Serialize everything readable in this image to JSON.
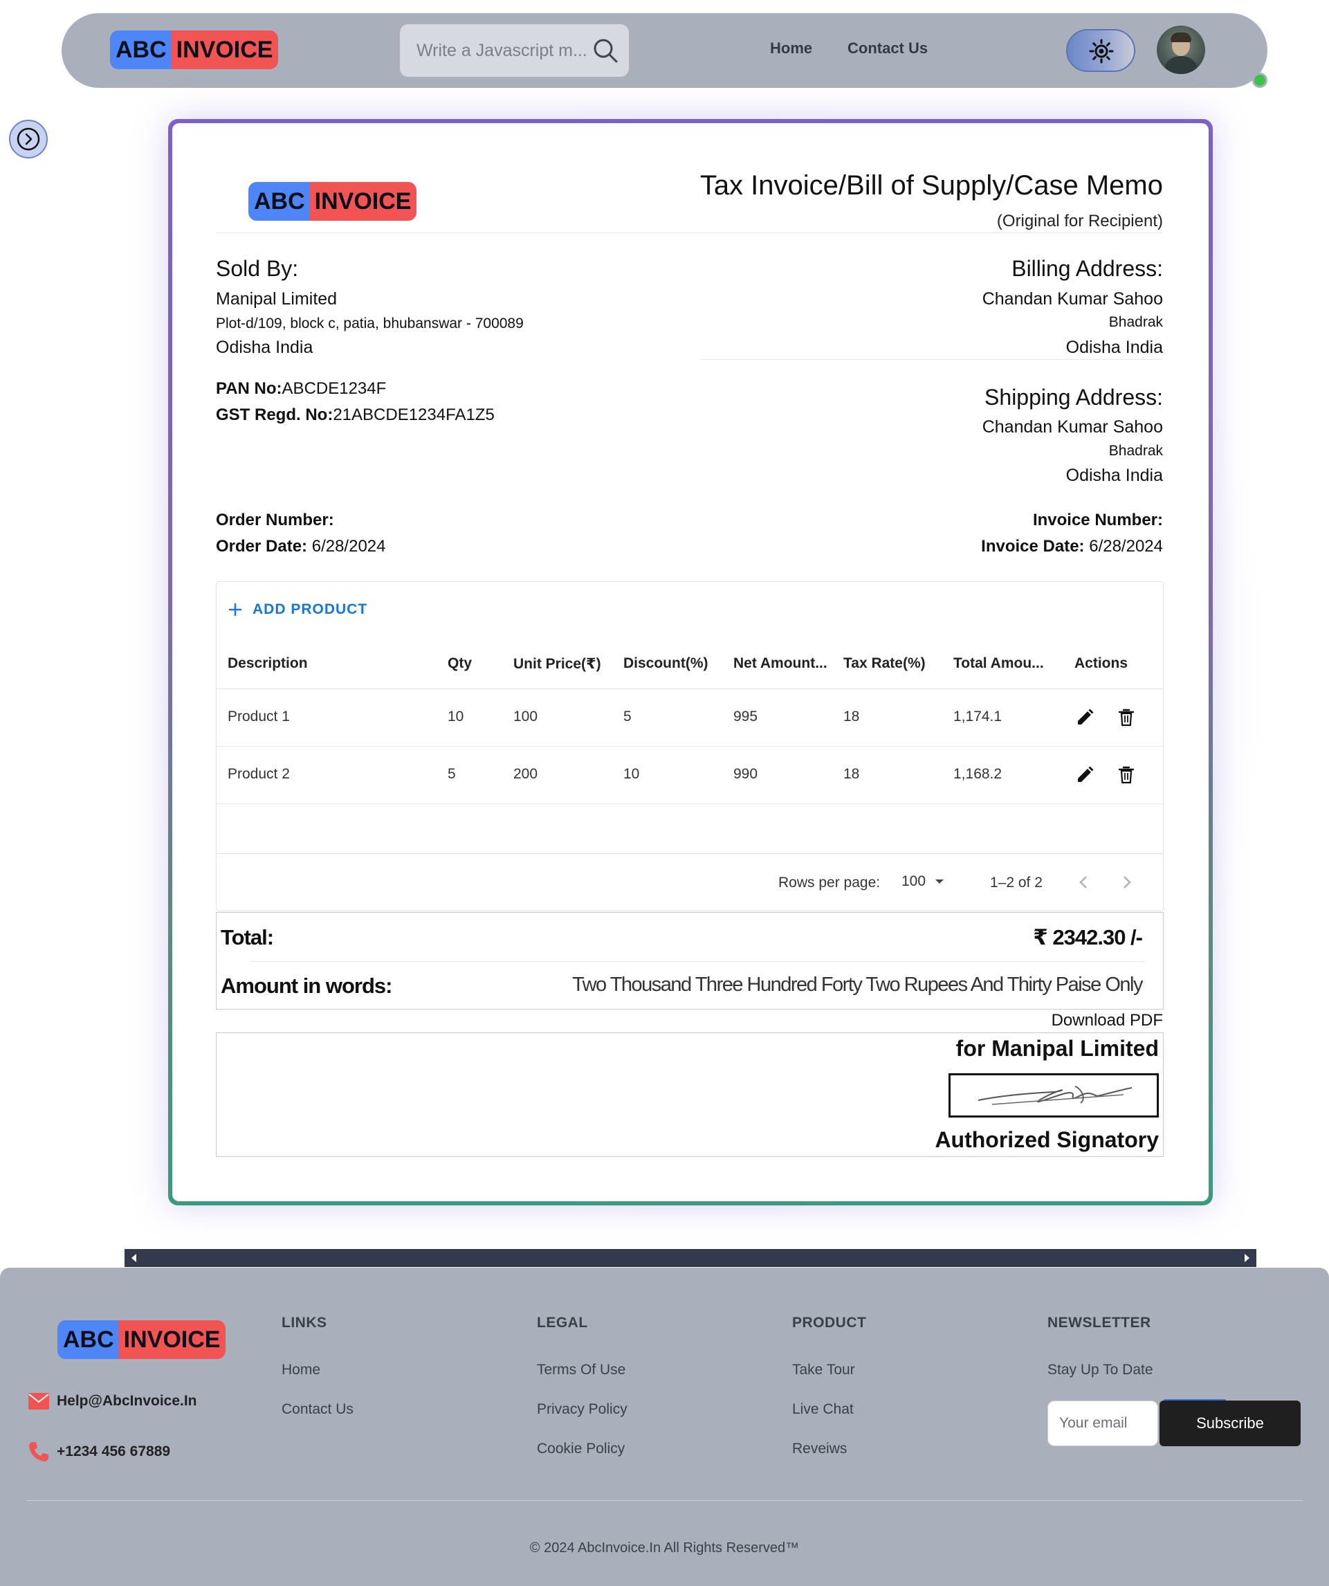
{
  "brand": {
    "abc": "ABC",
    "invoice": "INVOICE"
  },
  "nav": {
    "search_placeholder": "Write a Javascript m...",
    "home": "Home",
    "contact": "Contact Us",
    "theme_icon": "sun-icon",
    "online_status_color": "#3cc24a"
  },
  "invoice": {
    "title": "Tax Invoice/Bill of Supply/Case Memo",
    "subtitle": "(Original for Recipient)",
    "sold_by": {
      "heading": "Sold By:",
      "name": "Manipal Limited",
      "address": "Plot-d/109, block c, patia, bhubanswar - 700089",
      "state": "Odisha India",
      "pan_label": "PAN No:",
      "pan": "ABCDE1234F",
      "gst_label": "GST Regd. No:",
      "gst": "21ABCDE1234FA1Z5"
    },
    "billing": {
      "heading": "Billing Address:",
      "name": "Chandan Kumar Sahoo",
      "city": "Bhadrak",
      "state": "Odisha India"
    },
    "shipping": {
      "heading": "Shipping Address:",
      "name": "Chandan Kumar Sahoo",
      "city": "Bhadrak",
      "state": "Odisha India"
    },
    "order": {
      "number_label": "Order Number:",
      "date_label": "Order Date:",
      "date": "6/28/2024"
    },
    "inv": {
      "number_label": "Invoice Number:",
      "date_label": "Invoice Date:",
      "date": "6/28/2024"
    },
    "add_product": "ADD PRODUCT",
    "columns": [
      "Description",
      "Qty",
      "Unit Price(₹)",
      "Discount(%)",
      "Net Amount...",
      "Tax Rate(%)",
      "Total Amou...",
      "Actions"
    ],
    "rows": [
      {
        "description": "Product 1",
        "qty": "10",
        "unit_price": "100",
        "discount": "5",
        "net": "995",
        "tax": "18",
        "total": "1,174.1"
      },
      {
        "description": "Product 2",
        "qty": "5",
        "unit_price": "200",
        "discount": "10",
        "net": "990",
        "tax": "18",
        "total": "1,168.2"
      }
    ],
    "pagination": {
      "rows_label": "Rows per page:",
      "rows_value": "100",
      "range": "1–2 of 2"
    },
    "total_label": "Total:",
    "total_value": "₹ 2342.30 /-",
    "words_label": "Amount in words:",
    "words_value": "Two Thousand Three Hundred Forty Two Rupees And Thirty Paise Only",
    "download": "Download PDF",
    "for_company": "for Manipal Limited",
    "authorized": "Authorized Signatory"
  },
  "footer": {
    "email": "Help@AbcInvoice.In",
    "phone": "+1234 456 67889",
    "links": {
      "heading": "LINKS",
      "items": [
        "Home",
        "Contact Us"
      ]
    },
    "legal": {
      "heading": "LEGAL",
      "items": [
        "Terms Of Use",
        "Privacy Policy",
        "Cookie Policy"
      ]
    },
    "product": {
      "heading": "PRODUCT",
      "items": [
        "Take Tour",
        "Live Chat",
        "Reveiws"
      ]
    },
    "newsletter": {
      "heading": "NEWSLETTER",
      "text": "Stay Up To Date",
      "email_placeholder": "Your email",
      "subscribe": "Subscribe"
    },
    "copyright": "© 2024 AbcInvoice.In All Rights Reserved™"
  },
  "colors": {
    "accent_blue": "#4f86f7",
    "accent_red": "#f25454",
    "link_blue": "#1976d2",
    "nav_bg": "#a9b0bb"
  }
}
